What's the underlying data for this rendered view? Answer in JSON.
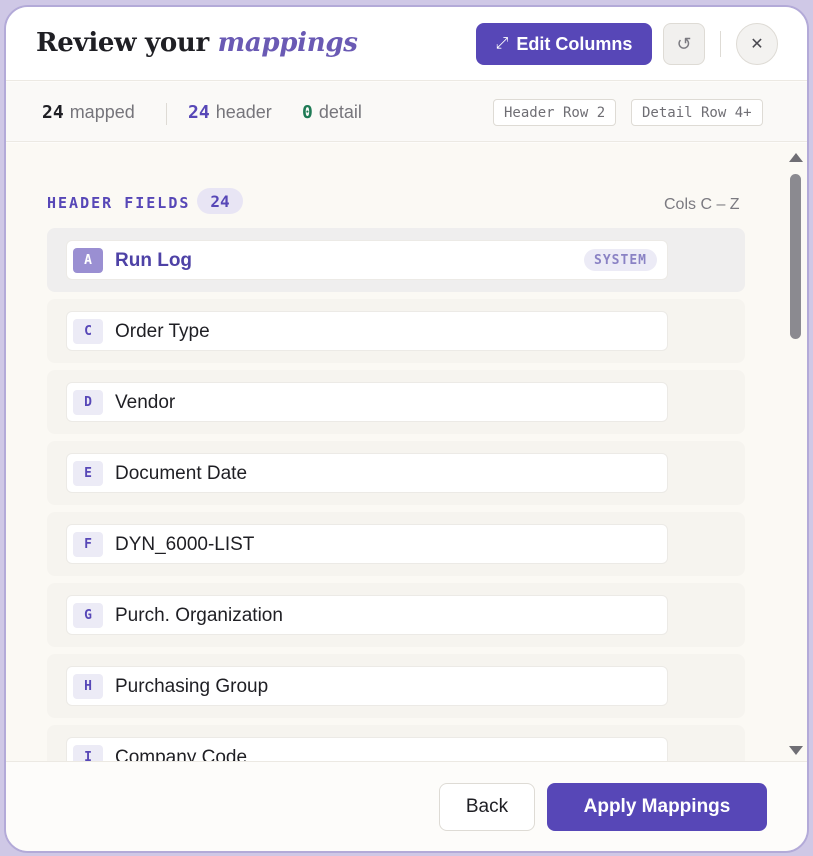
{
  "header": {
    "title_plain": "Review your",
    "title_accent": "mappings",
    "edit_columns_label": "Edit Columns",
    "edit_icon": "expand-arrows-icon",
    "undo_icon": "undo-icon",
    "close_icon": "close-icon"
  },
  "stats": {
    "mapped_count": "24",
    "mapped_label": "mapped",
    "header_count": "24",
    "header_label": "header",
    "detail_count": "0",
    "detail_label": "detail",
    "header_row_tag": "Header Row 2",
    "detail_row_tag": "Detail Row 4+"
  },
  "section": {
    "title": "HEADER FIELDS",
    "count": "24",
    "cols": "Cols C – Z"
  },
  "fields": [
    {
      "letter": "A",
      "label": "Run Log",
      "badge": "SYSTEM"
    },
    {
      "letter": "C",
      "label": "Order Type"
    },
    {
      "letter": "D",
      "label": "Vendor"
    },
    {
      "letter": "E",
      "label": "Document Date"
    },
    {
      "letter": "F",
      "label": "DYN_6000-LIST"
    },
    {
      "letter": "G",
      "label": "Purch. Organization"
    },
    {
      "letter": "H",
      "label": "Purchasing Group"
    },
    {
      "letter": "I",
      "label": "Company Code"
    }
  ],
  "footer": {
    "back_label": "Back",
    "apply_label": "Apply Mappings"
  },
  "colors": {
    "accent": "#5747b7",
    "detail_green": "#1e7a55",
    "modal_border": "#b3aad8"
  }
}
